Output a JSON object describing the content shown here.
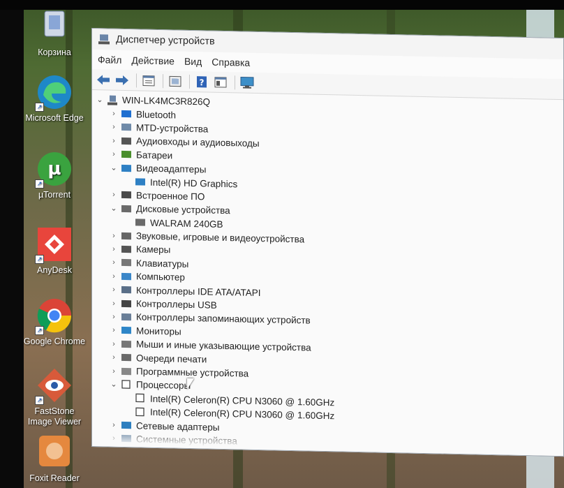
{
  "desktop": {
    "icons": [
      {
        "label": "Корзина",
        "icon": "recycle-bin-icon"
      },
      {
        "label": "Microsoft Edge",
        "icon": "edge-icon"
      },
      {
        "label": "µTorrent",
        "icon": "utorrent-icon"
      },
      {
        "label": "AnyDesk",
        "icon": "anydesk-icon"
      },
      {
        "label": "Google Chrome",
        "icon": "chrome-icon"
      },
      {
        "label": "FastStone Image Viewer",
        "icon": "faststone-icon"
      },
      {
        "label": "Foxit Reader",
        "icon": "foxit-icon"
      }
    ]
  },
  "window": {
    "title": "Диспетчер устройств",
    "menu": [
      "Файл",
      "Действие",
      "Вид",
      "Справка"
    ],
    "toolbar": [
      "back-arrow-icon",
      "forward-arrow-icon",
      "properties-icon",
      "update-driver-icon",
      "help-icon",
      "view-icon",
      "monitor-scan-icon"
    ]
  },
  "tree": {
    "root": "WIN-LK4MC3R826Q",
    "categories": [
      {
        "label": "Bluetooth",
        "icon": "bluetooth-icon",
        "expanded": false
      },
      {
        "label": "MTD-устройства",
        "icon": "mtd-device-icon",
        "expanded": false
      },
      {
        "label": "Аудиовходы и аудиовыходы",
        "icon": "audio-icon",
        "expanded": false
      },
      {
        "label": "Батареи",
        "icon": "battery-icon",
        "expanded": false
      },
      {
        "label": "Видеоадаптеры",
        "icon": "display-adapter-icon",
        "expanded": true,
        "children": [
          "Intel(R) HD Graphics"
        ]
      },
      {
        "label": "Встроенное ПО",
        "icon": "firmware-icon",
        "expanded": false
      },
      {
        "label": "Дисковые устройства",
        "icon": "disk-drive-icon",
        "expanded": true,
        "children": [
          "WALRAM 240GB"
        ]
      },
      {
        "label": "Звуковые, игровые и видеоустройства",
        "icon": "speaker-icon",
        "expanded": false
      },
      {
        "label": "Камеры",
        "icon": "camera-icon",
        "expanded": false
      },
      {
        "label": "Клавиатуры",
        "icon": "keyboard-icon",
        "expanded": false
      },
      {
        "label": "Компьютер",
        "icon": "computer-icon",
        "expanded": false
      },
      {
        "label": "Контроллеры IDE ATA/ATAPI",
        "icon": "ide-controller-icon",
        "expanded": false
      },
      {
        "label": "Контроллеры USB",
        "icon": "usb-icon",
        "expanded": false
      },
      {
        "label": "Контроллеры запоминающих устройств",
        "icon": "storage-controller-icon",
        "expanded": false
      },
      {
        "label": "Мониторы",
        "icon": "monitor-icon",
        "expanded": false
      },
      {
        "label": "Мыши и иные указывающие устройства",
        "icon": "mouse-icon",
        "expanded": false
      },
      {
        "label": "Очереди печати",
        "icon": "printer-icon",
        "expanded": false
      },
      {
        "label": "Программные устройства",
        "icon": "software-device-icon",
        "expanded": false
      },
      {
        "label": "Процессоры",
        "icon": "processor-icon",
        "expanded": true,
        "children": [
          "Intel(R) Celeron(R) CPU  N3060  @ 1.60GHz",
          "Intel(R) Celeron(R) CPU  N3060  @ 1.60GHz"
        ]
      },
      {
        "label": "Сетевые адаптеры",
        "icon": "network-adapter-icon",
        "expanded": false
      },
      {
        "label": "Системные устройства",
        "icon": "system-device-icon",
        "expanded": false
      }
    ]
  },
  "colors": {
    "window_bg": "#fafafa",
    "text": "#222222",
    "accent": "#1f73c7"
  }
}
